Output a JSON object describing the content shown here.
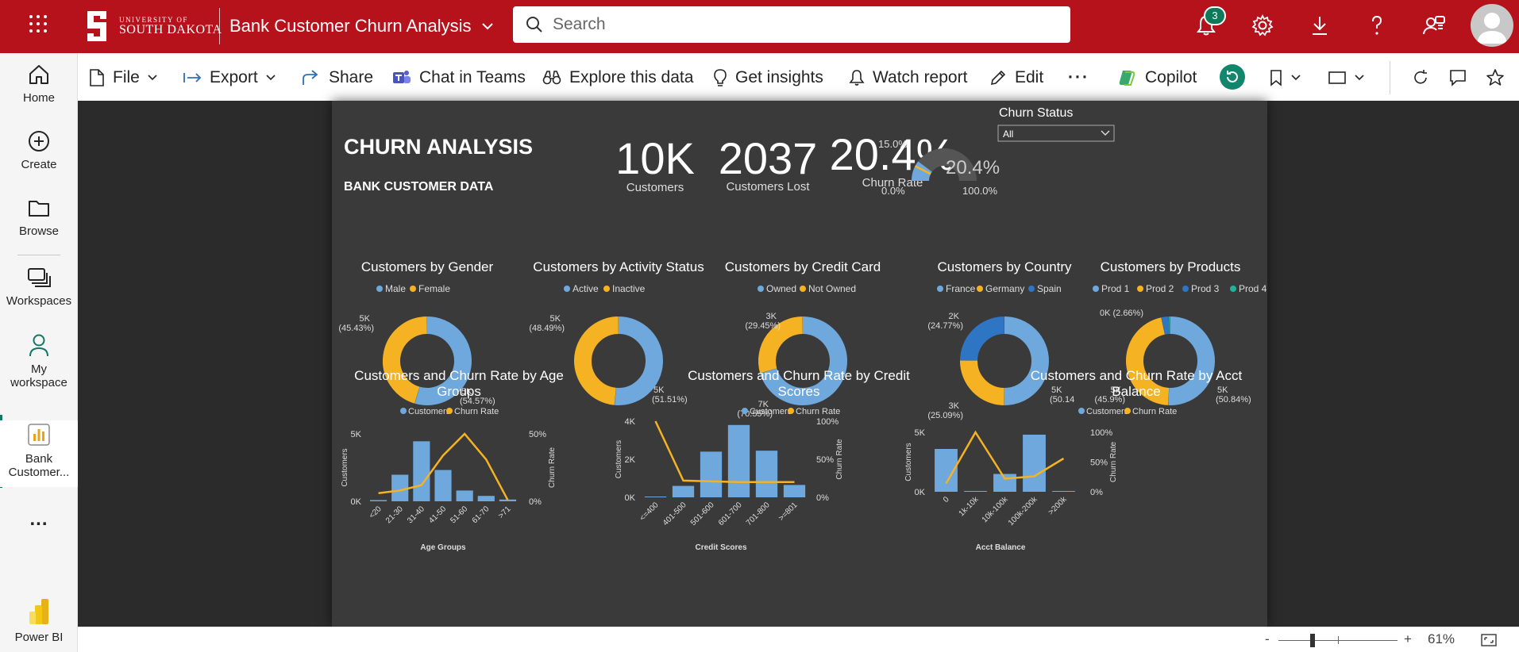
{
  "app": {
    "org_small": "UNIVERSITY OF",
    "org_big": "SOUTH DAKOTA",
    "report_title": "Bank Customer Churn Analysis",
    "search_placeholder": "Search",
    "notification_count": "3"
  },
  "nav": {
    "home": "Home",
    "create": "Create",
    "browse": "Browse",
    "workspaces": "Workspaces",
    "my_workspace_1": "My",
    "my_workspace_2": "workspace",
    "bank_1": "Bank",
    "bank_2": "Customer...",
    "more": "...",
    "powerbi": "Power BI"
  },
  "toolbar": {
    "file": "File",
    "export": "Export",
    "share": "Share",
    "chat_teams": "Chat in Teams",
    "explore": "Explore this data",
    "insights": "Get insights",
    "watch": "Watch report",
    "edit": "Edit",
    "more": "···",
    "copilot": "Copilot"
  },
  "status": {
    "zoom_minus": "-",
    "zoom_plus": "+",
    "zoom_level": "61%"
  },
  "report": {
    "title": "CHURN ANALYSIS",
    "subtitle": "BANK CUSTOMER DATA",
    "kpis": [
      {
        "value": "10K",
        "label": "Customers"
      },
      {
        "value": "2037",
        "label": "Customers Lost"
      },
      {
        "value": "20.4%",
        "label": "Churn Rate"
      }
    ],
    "gauge": {
      "value": 20.4,
      "value_label": "20.4%",
      "min": "0.0%",
      "max": "100.0%",
      "target": 15.0,
      "target_label": "15.0%"
    },
    "slicer": {
      "title": "Churn Status",
      "selected": "All"
    }
  },
  "chart_data": [
    {
      "type": "pie",
      "title": "Customers by Gender",
      "slices": [
        {
          "name": "Male",
          "value": 54.57,
          "label": "5K",
          "pct": "(54.57%)",
          "color": "#6ea8dc"
        },
        {
          "name": "Female",
          "value": 45.43,
          "label": "5K",
          "pct": "(45.43%)",
          "color": "#f5b324"
        }
      ]
    },
    {
      "type": "pie",
      "title": "Customers by Activity Status",
      "slices": [
        {
          "name": "Active",
          "value": 51.51,
          "label": "5K",
          "pct": "(51.51%)",
          "color": "#6ea8dc"
        },
        {
          "name": "Inactive",
          "value": 48.49,
          "label": "5K",
          "pct": "(48.49%)",
          "color": "#f5b324"
        }
      ]
    },
    {
      "type": "pie",
      "title": "Customers by Credit Card",
      "slices": [
        {
          "name": "Owned",
          "value": 70.55,
          "label": "7K",
          "pct": "(70.55%)",
          "color": "#6ea8dc"
        },
        {
          "name": "Not Owned",
          "value": 29.45,
          "label": "3K",
          "pct": "(29.45%)",
          "color": "#f5b324"
        }
      ]
    },
    {
      "type": "pie",
      "title": "Customers by Country",
      "slices": [
        {
          "name": "France",
          "value": 50.14,
          "label": "5K",
          "pct": "(50.14",
          "color": "#6ea8dc"
        },
        {
          "name": "Germany",
          "value": 25.09,
          "label": "3K",
          "pct": "(25.09%)",
          "color": "#f5b324"
        },
        {
          "name": "Spain",
          "value": 24.77,
          "label": "2K",
          "pct": "(24.77%)",
          "color": "#2e75c4"
        }
      ]
    },
    {
      "type": "pie",
      "title": "Customers by Products",
      "slices": [
        {
          "name": "Prod 1",
          "value": 50.84,
          "label": "5K",
          "pct": "(50.84%)",
          "color": "#6ea8dc"
        },
        {
          "name": "Prod 2",
          "value": 45.9,
          "label": "5K",
          "pct": "(45.9%)",
          "color": "#f5b324"
        },
        {
          "name": "Prod 3",
          "value": 2.66,
          "label": "0K",
          "pct": "(2.66%)",
          "color": "#2e75c4"
        },
        {
          "name": "Prod 4",
          "value": 0.6,
          "label": "",
          "pct": "",
          "color": "#20b39a"
        }
      ]
    },
    {
      "type": "bar",
      "title": "Customers and Churn Rate by Age Groups",
      "xlabel": "Age Groups",
      "ylabel": "Customers",
      "y2label": "Churn Rate",
      "categories": [
        "<20",
        "21-30",
        "31-40",
        "41-50",
        "51-60",
        "61-70",
        ">71"
      ],
      "series": [
        {
          "name": "Customers",
          "values": [
            90,
            1970,
            4450,
            2320,
            800,
            400,
            130
          ],
          "color": "#6ea8dc"
        },
        {
          "name": "Churn Rate",
          "values": [
            6,
            8,
            12,
            34,
            56,
            31,
            1
          ],
          "color": "#f5b324",
          "axis": "right"
        }
      ],
      "ylim": [
        0,
        5000
      ],
      "y2lim": [
        0,
        50
      ],
      "yticks": [
        "0K",
        "5K"
      ],
      "y2ticks": [
        "0%",
        "50%"
      ]
    },
    {
      "type": "bar",
      "title": "Customers and Churn Rate by Credit Scores",
      "xlabel": "Credit Scores",
      "ylabel": "Customers",
      "y2label": "Churn Rate",
      "categories": [
        "<=400",
        "401-500",
        "501-600",
        "601-700",
        "701-800",
        ">=801"
      ],
      "series": [
        {
          "name": "Customers",
          "values": [
            19,
            600,
            2400,
            3800,
            2450,
            650
          ],
          "color": "#6ea8dc"
        },
        {
          "name": "Churn Rate",
          "values": [
            100,
            22,
            21,
            20,
            20,
            20
          ],
          "color": "#f5b324",
          "axis": "right"
        }
      ],
      "ylim": [
        0,
        4000
      ],
      "y2lim": [
        0,
        100
      ],
      "yticks": [
        "0K",
        "2K",
        "4K"
      ],
      "y2ticks": [
        "0%",
        "50%",
        "100%"
      ]
    },
    {
      "type": "bar",
      "title": "Customers and Churn Rate by Acct Balance",
      "xlabel": "Acct Balance",
      "ylabel": "Customers",
      "y2label": "Churn Rate",
      "categories": [
        "0",
        "1k-10k",
        "10k-100k",
        "100k-200k",
        ">200k"
      ],
      "series": [
        {
          "name": "Customers",
          "values": [
            3600,
            15,
            1500,
            4800,
            35
          ],
          "color": "#6ea8dc"
        },
        {
          "name": "Churn Rate",
          "values": [
            14,
            100,
            22,
            26,
            56
          ],
          "color": "#f5b324",
          "axis": "right"
        }
      ],
      "ylim": [
        0,
        5000
      ],
      "y2lim": [
        0,
        100
      ],
      "yticks": [
        "0K",
        "5K"
      ],
      "y2ticks": [
        "0%",
        "50%",
        "100%"
      ]
    }
  ]
}
